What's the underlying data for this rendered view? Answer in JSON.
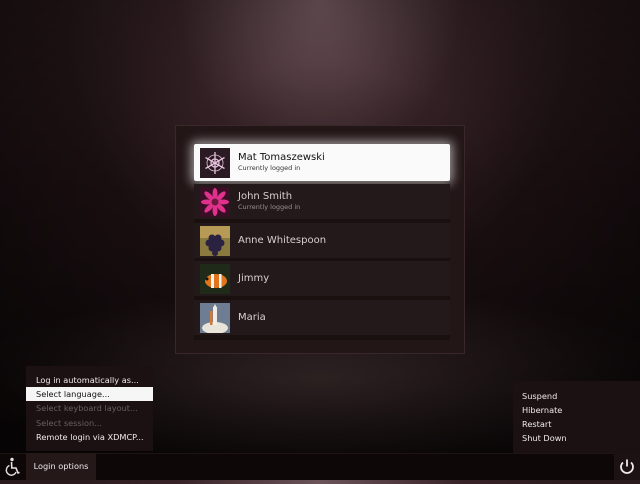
{
  "users": [
    {
      "name": "Mat Tomaszewski",
      "status": "Currently logged in",
      "avatar": "snowflake-avatar",
      "selected": true
    },
    {
      "name": "John Smith",
      "status": "Currently logged in",
      "avatar": "pink-flower-avatar"
    },
    {
      "name": "Anne Whitespoon",
      "status": "",
      "avatar": "grapes-avatar"
    },
    {
      "name": "Jimmy",
      "status": "",
      "avatar": "clownfish-avatar"
    },
    {
      "name": "Maria",
      "status": "",
      "avatar": "shuttle-launch-avatar"
    }
  ],
  "login_menu": {
    "items": [
      {
        "label": "Log in automatically as...",
        "state": "normal"
      },
      {
        "label": "Select language...",
        "state": "hover"
      },
      {
        "label": "Select keyboard layout...",
        "state": "disabled"
      },
      {
        "label": "Select session...",
        "state": "disabled"
      },
      {
        "label": "Remote login via XDMCP...",
        "state": "normal"
      }
    ]
  },
  "power_menu": {
    "items": [
      "Suspend",
      "Hibernate",
      "Restart",
      "Shut Down"
    ]
  },
  "bottom_bar": {
    "login_options_label": "Login options",
    "accessibility_icon": "accessibility-icon",
    "power_icon": "power-icon"
  }
}
